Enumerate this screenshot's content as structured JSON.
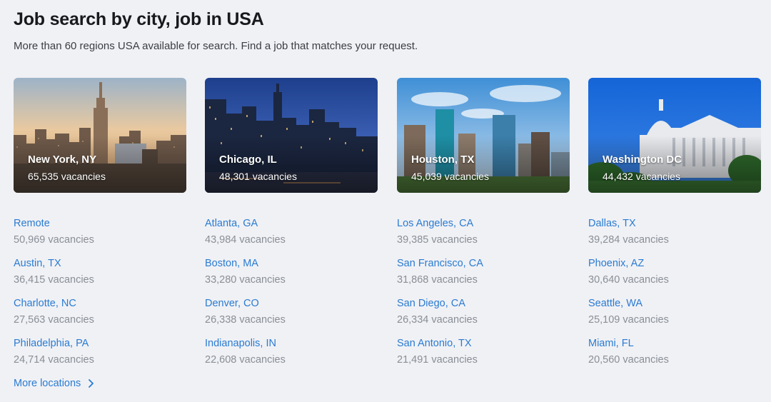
{
  "header": {
    "title": "Job search by city, job in USA",
    "subtitle": "More than 60 regions USA available for search. Find a job that matches your request."
  },
  "featured": [
    {
      "city": "New York, NY",
      "vacancies": "65,535 vacancies"
    },
    {
      "city": "Chicago, IL",
      "vacancies": "48,301 vacancies"
    },
    {
      "city": "Houston, TX",
      "vacancies": "45,039 vacancies"
    },
    {
      "city": "Washington DC",
      "vacancies": "44,432 vacancies"
    }
  ],
  "columns": [
    [
      {
        "name": "Remote",
        "vacancies": "50,969 vacancies"
      },
      {
        "name": "Austin, TX",
        "vacancies": "36,415 vacancies"
      },
      {
        "name": "Charlotte, NC",
        "vacancies": "27,563 vacancies"
      },
      {
        "name": "Philadelphia, PA",
        "vacancies": "24,714 vacancies"
      }
    ],
    [
      {
        "name": "Atlanta, GA",
        "vacancies": "43,984 vacancies"
      },
      {
        "name": "Boston, MA",
        "vacancies": "33,280 vacancies"
      },
      {
        "name": "Denver, CO",
        "vacancies": "26,338 vacancies"
      },
      {
        "name": "Indianapolis, IN",
        "vacancies": "22,608 vacancies"
      }
    ],
    [
      {
        "name": "Los Angeles, CA",
        "vacancies": "39,385 vacancies"
      },
      {
        "name": "San Francisco, CA",
        "vacancies": "31,868 vacancies"
      },
      {
        "name": "San Diego, CA",
        "vacancies": "26,334 vacancies"
      },
      {
        "name": "San Antonio, TX",
        "vacancies": "21,491 vacancies"
      }
    ],
    [
      {
        "name": "Dallas, TX",
        "vacancies": "39,284 vacancies"
      },
      {
        "name": "Phoenix, AZ",
        "vacancies": "30,640 vacancies"
      },
      {
        "name": "Seattle, WA",
        "vacancies": "25,109 vacancies"
      },
      {
        "name": "Miami, FL",
        "vacancies": "20,560 vacancies"
      }
    ]
  ],
  "more": {
    "label": "More locations",
    "icon": "chevron-right-icon"
  },
  "colors": {
    "link": "#2a7bd1",
    "muted": "#8a8e96",
    "background": "#f0f1f5"
  }
}
